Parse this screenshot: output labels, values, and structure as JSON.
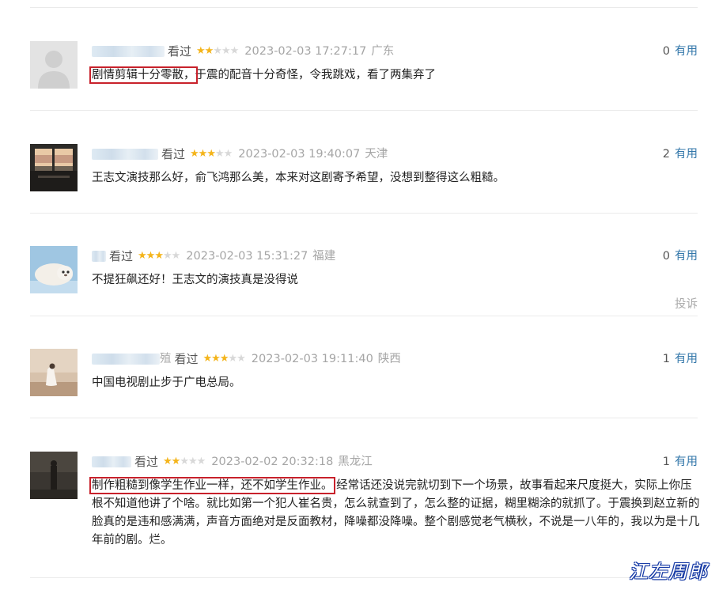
{
  "comments": [
    {
      "status": "看过",
      "rating": 2,
      "stars": {
        "on": "★★",
        "off": "★★★"
      },
      "datetime": "2023-02-03 17:27:17",
      "location": "广东",
      "votes": "0",
      "useful_label": "有用",
      "highlight": "剧情剪辑十分零散，",
      "text": "于震的配音十分奇怪，令我跳戏，看了两集弃了"
    },
    {
      "status": "看过",
      "rating": 3,
      "stars": {
        "on": "★★★",
        "off": "★★"
      },
      "datetime": "2023-02-03 19:40:07",
      "location": "天津",
      "votes": "2",
      "useful_label": "有用",
      "highlight": "",
      "text": "王志文演技那么好，俞飞鸿那么美，本来对这剧寄予希望，没想到整得这么粗糙。"
    },
    {
      "status": "看过",
      "rating": 3,
      "stars": {
        "on": "★★★",
        "off": "★★"
      },
      "datetime": "2023-02-03 15:31:27",
      "location": "福建",
      "votes": "0",
      "useful_label": "有用",
      "highlight": "",
      "text": "不提狂飙还好！王志文的演技真是没得说",
      "report_label": "投诉"
    },
    {
      "status": "看过",
      "rating": 3,
      "stars": {
        "on": "★★★",
        "off": "★★"
      },
      "datetime": "2023-02-03 19:11:40",
      "location": "陕西",
      "votes": "1",
      "useful_label": "有用",
      "highlight": "",
      "text": "中国电视剧止步于广电总局。",
      "name_tail": "殖"
    },
    {
      "status": "看过",
      "rating": 2,
      "stars": {
        "on": "★★",
        "off": "★★★"
      },
      "datetime": "2023-02-02 20:32:18",
      "location": "黑龙江",
      "votes": "1",
      "useful_label": "有用",
      "highlight": "制作粗糙到像学生作业一样，还不如学生作业。",
      "text": "经常话还没说完就切到下一个场景，故事看起来尺度挺大，实际上你压根不知道他讲了个啥。就比如第一个犯人崔名贵，怎么就查到了，怎么整的证据，糊里糊涂的就抓了。于震换到赵立新的脸真的是违和感满满，声音方面绝对是反面教材，降噪都没降噪。整个剧感觉老气横秋，不说是一八年的，我以为是十几年前的剧。烂。"
    }
  ],
  "watermark": "江左周郎",
  "colors": {
    "link": "#3377aa",
    "star_on": "#f4b41a",
    "star_off": "#d8d8d8",
    "highlight_box": "#c8212b"
  }
}
